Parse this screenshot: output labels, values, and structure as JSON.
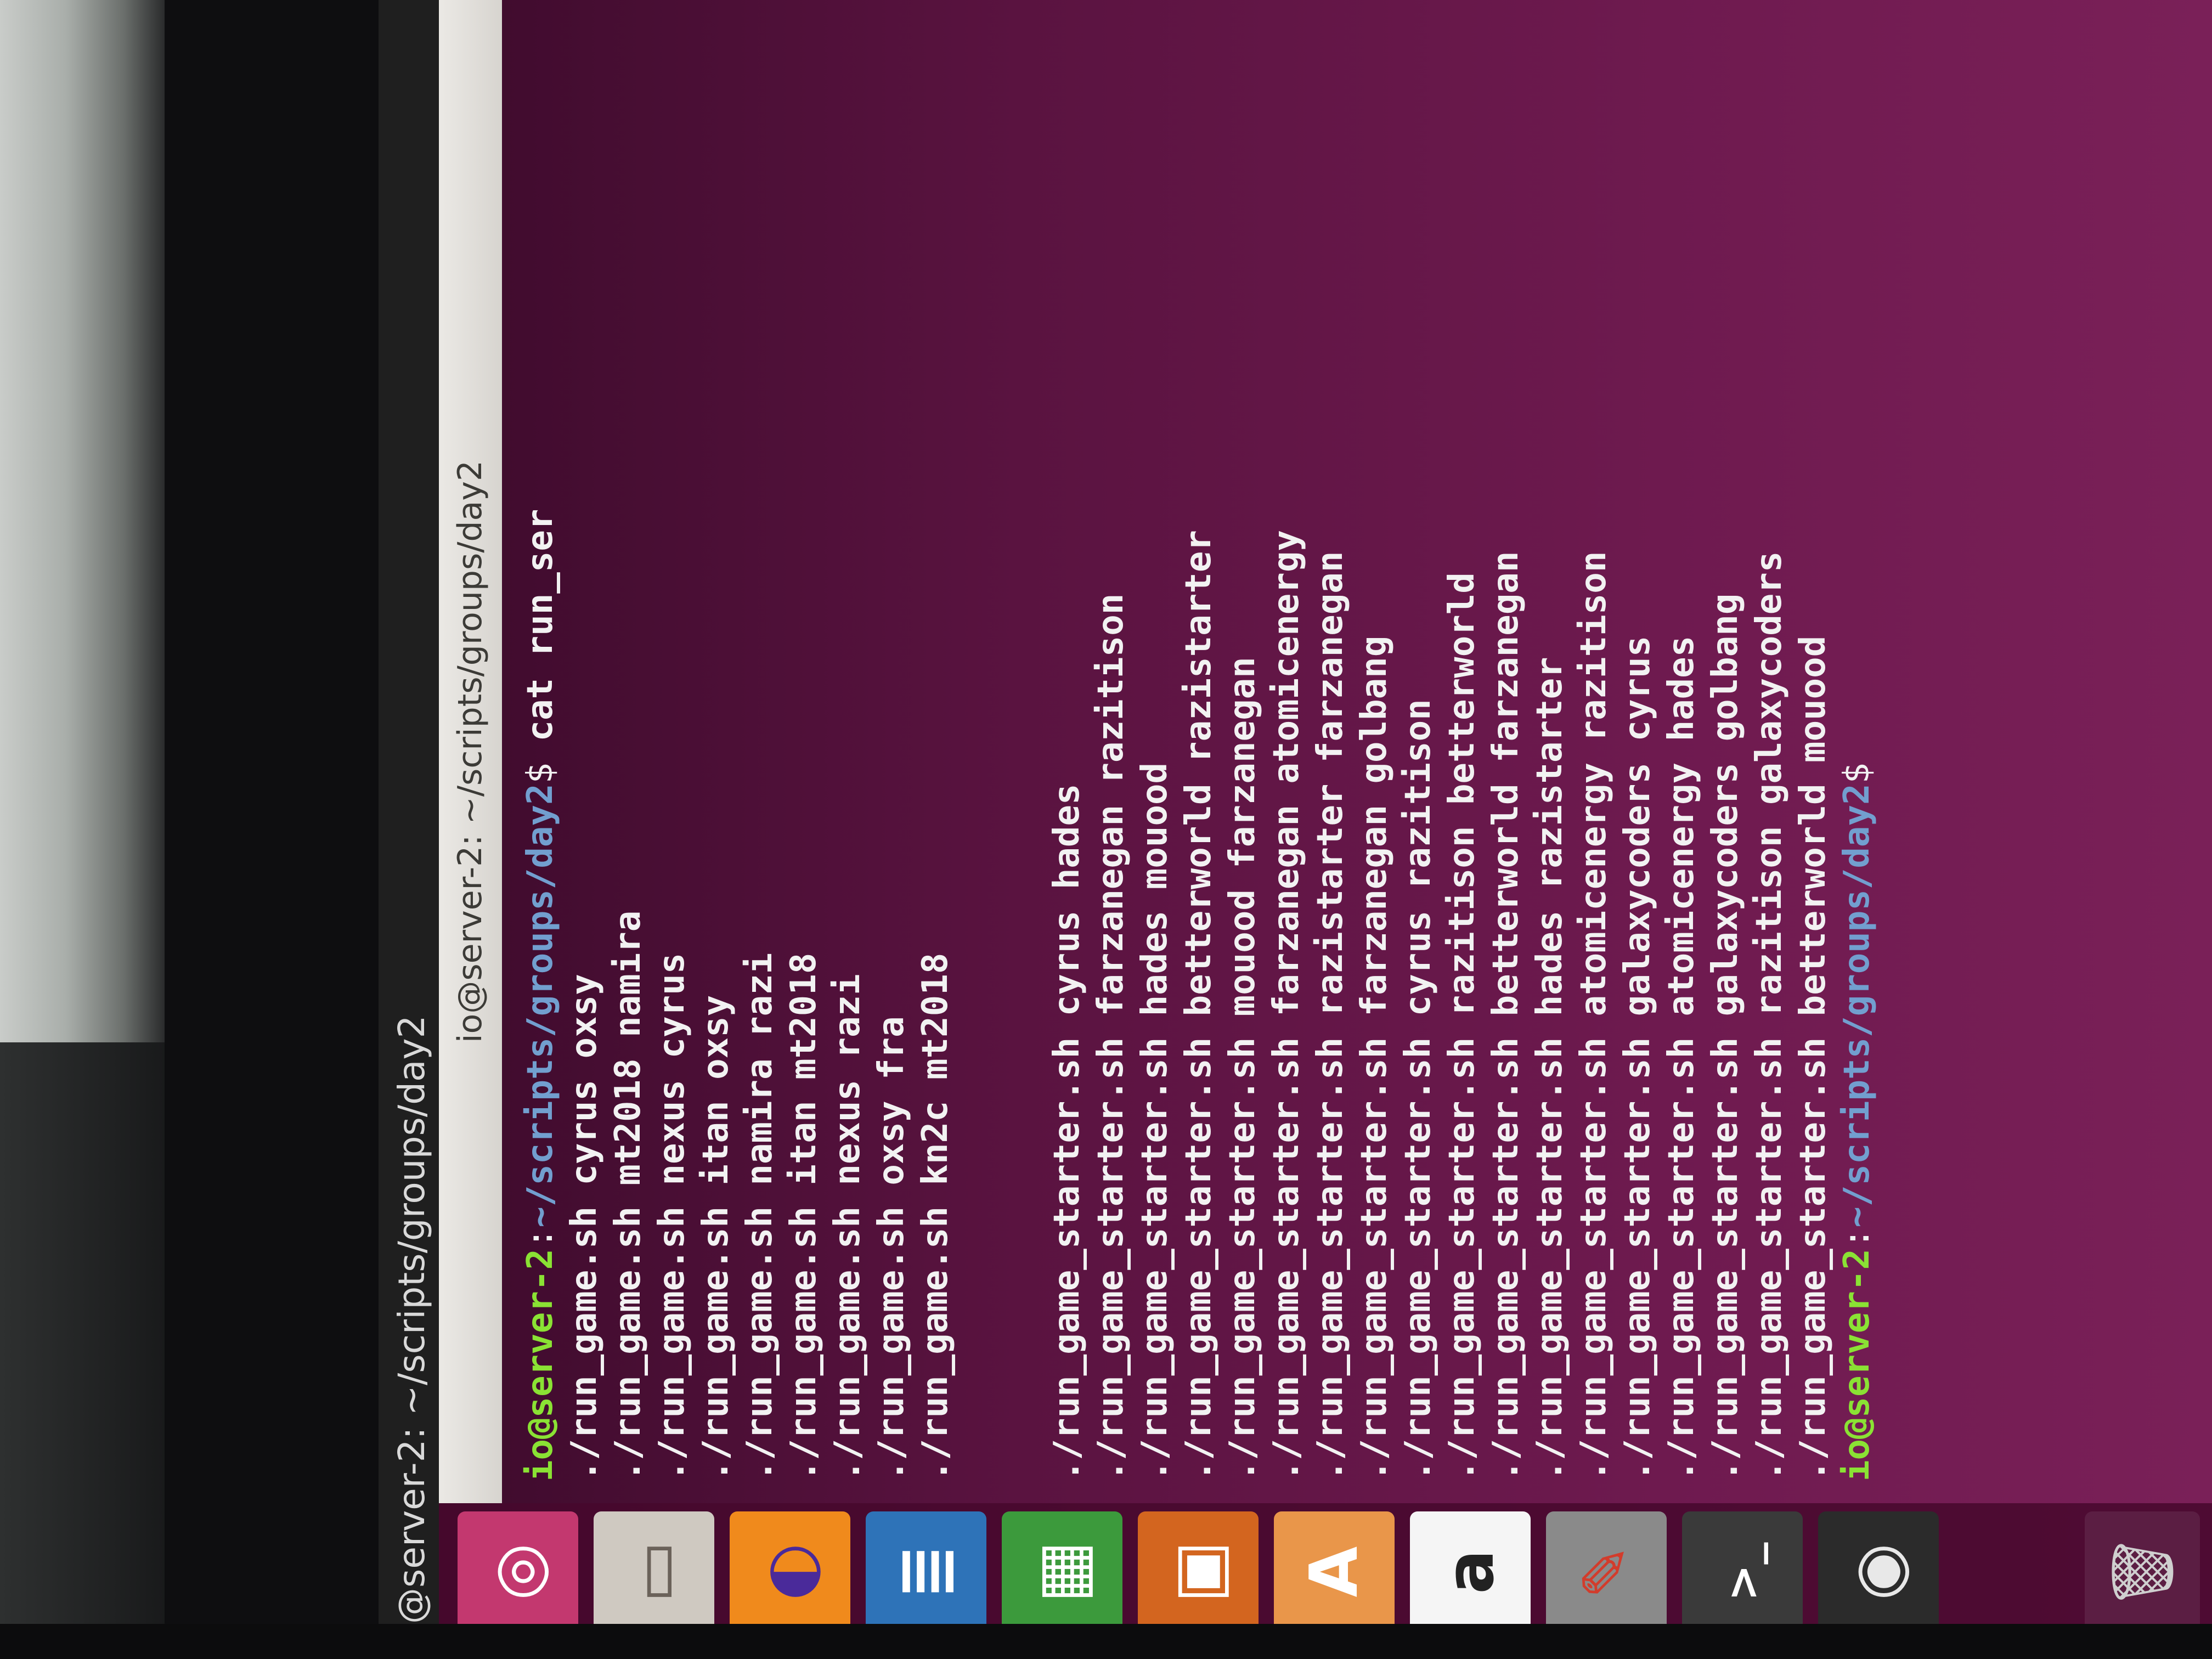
{
  "top_panel": {
    "title": "@server-2: ~/scripts/groups/day2"
  },
  "terminal": {
    "window_title": "io@server-2: ~/scripts/groups/day2",
    "prompt_user_host": "io@server-2",
    "prompt_path": "~/scripts/groups/day2",
    "prompt_sep": ":",
    "prompt_dollar": "$",
    "command": " cat run_ser",
    "output_lines": [
      "./run_game.sh cyrus oxsy",
      "./run_game.sh mt2018 namira",
      "./run_game.sh nexus cyrus",
      "./run_game.sh itan oxsy",
      "./run_game.sh namira razi",
      "./run_game.sh itan mt2018",
      "./run_game.sh nexus razi",
      "./run_game.sh oxsy fra",
      "./run_game.sh kn2c mt2018",
      "",
      "",
      "./run_game_starter.sh cyrus hades",
      "./run_game_starter.sh farzanegan razitison",
      "./run_game_starter.sh hades mouood",
      "./run_game_starter.sh betterworld razistarter",
      "./run_game_starter.sh mouood farzanegan",
      "./run_game_starter.sh farzanegan atomicenergy",
      "./run_game_starter.sh razistarter farzanegan",
      "./run_game_starter.sh farzanegan golbang",
      "./run_game_starter.sh cyrus razitison",
      "./run_game_starter.sh razitison betterworld",
      "./run_game_starter.sh betterworld farzanegan",
      "./run_game_starter.sh hades razistarter",
      "./run_game_starter.sh atomicenergy razitison",
      "./run_game_starter.sh galaxycoders cyrus",
      "./run_game_starter.sh atomicenergy hades",
      "./run_game_starter.sh galaxycoders golbang",
      "./run_game_starter.sh razitison galaxycoders",
      "./run_game_starter.sh betterworld mouood"
    ],
    "final_prompt_user_host": "io@server-2",
    "final_prompt_path": "~/scripts/groups/day2",
    "final_prompt_dollar": "$"
  },
  "launcher": {
    "items": [
      {
        "name": "ubuntu-logo-icon",
        "glyph": "◎",
        "bg": "#c3386f",
        "fg": "#ffffff"
      },
      {
        "name": "files-icon",
        "glyph": "▭",
        "bg": "#cfc9c1",
        "fg": "#6b625a"
      },
      {
        "name": "firefox-icon",
        "glyph": "◐",
        "bg": "#f08a1c",
        "fg": "#4a2a9a"
      },
      {
        "name": "libreoffice-writer-icon",
        "glyph": "≣",
        "bg": "#2e73b8",
        "fg": "#ffffff"
      },
      {
        "name": "libreoffice-calc-icon",
        "glyph": "▦",
        "bg": "#3c9a3c",
        "fg": "#ffffff"
      },
      {
        "name": "libreoffice-impress-icon",
        "glyph": "▣",
        "bg": "#d3651f",
        "fg": "#ffffff"
      },
      {
        "name": "software-center-icon",
        "glyph": "A",
        "bg": "#e9964a",
        "fg": "#ffffff"
      },
      {
        "name": "amazon-icon",
        "glyph": "a",
        "bg": "#f5f5f5",
        "fg": "#222222"
      },
      {
        "name": "system-settings-icon",
        "glyph": "✎",
        "bg": "#8a8a8a",
        "fg": "#d23c2c"
      },
      {
        "name": "terminal-icon",
        "glyph": ">_",
        "bg": "#3a3a3a",
        "fg": "#ffffff"
      },
      {
        "name": "obs-studio-icon",
        "glyph": "◉",
        "bg": "#2b2b2b",
        "fg": "#e8e8e8"
      }
    ],
    "trash_glyph": "🗑"
  }
}
